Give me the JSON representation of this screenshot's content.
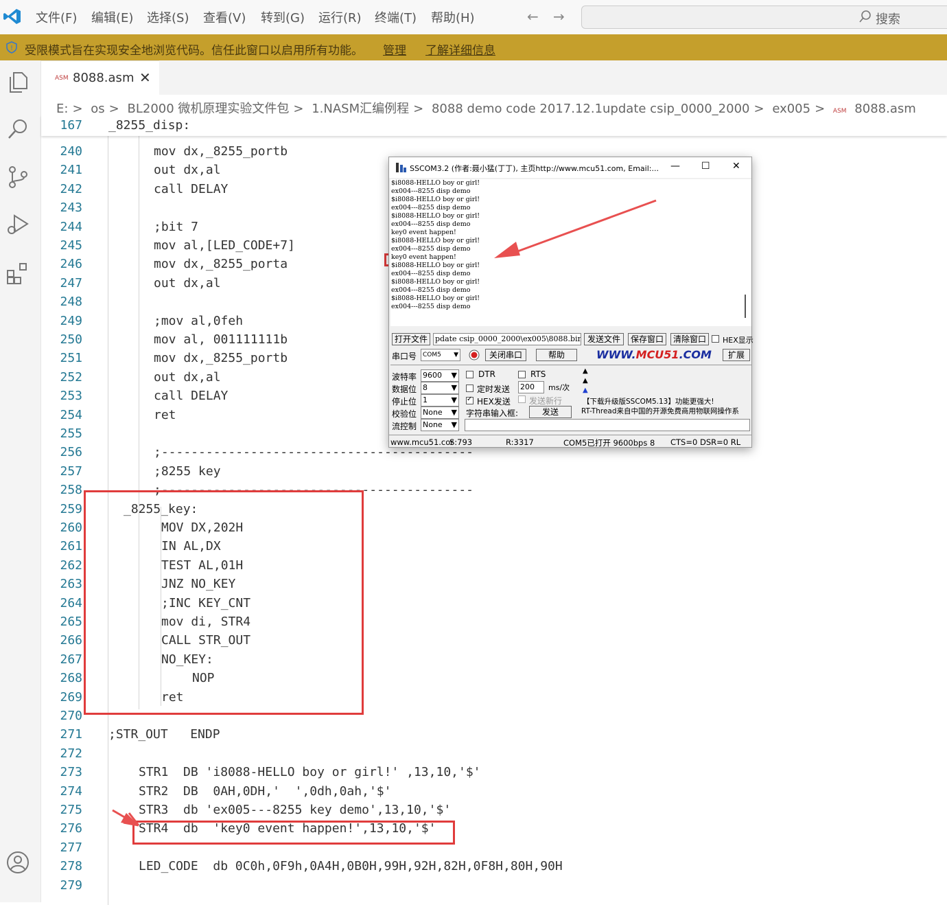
{
  "menubar": {
    "items": [
      "文件(F)",
      "编辑(E)",
      "选择(S)",
      "查看(V)",
      "转到(G)",
      "运行(R)",
      "终端(T)",
      "帮助(H)"
    ],
    "search_placeholder": "搜索"
  },
  "restricted_banner": {
    "text": "受限模式旨在实现安全地浏览代码。信任此窗口以启用所有功能。",
    "manage": "管理",
    "learn_more": "了解详细信息"
  },
  "tab": {
    "badge": "ASM",
    "name": "8088.asm"
  },
  "breadcrumb": [
    "E:",
    "os",
    "BL2000 微机原理实验文件包",
    "1.NASM汇编例程",
    "8088 demo code 2017.12.1update csip_0000_2000",
    "ex005",
    "8088.asm"
  ],
  "sticky_line": {
    "number": "167",
    "code": "_8255_disp:"
  },
  "lines": [
    {
      "n": "240",
      "code": "mov dx,_8255_portb",
      "indent": 3
    },
    {
      "n": "241",
      "code": "out dx,al",
      "indent": 3
    },
    {
      "n": "242",
      "code": "call DELAY",
      "indent": 3
    },
    {
      "n": "243",
      "code": "",
      "indent": 3
    },
    {
      "n": "244",
      "code": ";bit 7",
      "indent": 3
    },
    {
      "n": "245",
      "code": "mov al,[LED_CODE+7]",
      "indent": 3
    },
    {
      "n": "246",
      "code": "mov dx,_8255_porta",
      "indent": 3
    },
    {
      "n": "247",
      "code": "out dx,al",
      "indent": 3
    },
    {
      "n": "248",
      "code": "",
      "indent": 3
    },
    {
      "n": "249",
      "code": ";mov al,0feh",
      "indent": 3
    },
    {
      "n": "250",
      "code": "mov al, 001111111b",
      "indent": 3
    },
    {
      "n": "251",
      "code": "mov dx,_8255_portb",
      "indent": 3
    },
    {
      "n": "252",
      "code": "out dx,al",
      "indent": 3
    },
    {
      "n": "253",
      "code": "call DELAY",
      "indent": 3
    },
    {
      "n": "254",
      "code": "ret",
      "indent": 3
    },
    {
      "n": "255",
      "code": "",
      "indent": 3
    },
    {
      "n": "256",
      "code": ";------------------------------------------",
      "indent": 3
    },
    {
      "n": "257",
      "code": ";8255 key",
      "indent": 3
    },
    {
      "n": "258",
      "code": ";------------------------------------------",
      "indent": 3
    },
    {
      "n": "259",
      "code": "_8255_key:",
      "indent": 1
    },
    {
      "n": "260",
      "code": "MOV DX,202H",
      "indent": 2
    },
    {
      "n": "261",
      "code": "IN AL,DX",
      "indent": 2
    },
    {
      "n": "262",
      "code": "TEST AL,01H",
      "indent": 2
    },
    {
      "n": "263",
      "code": "JNZ NO_KEY",
      "indent": 2
    },
    {
      "n": "264",
      "code": ";INC KEY_CNT",
      "indent": 2
    },
    {
      "n": "265",
      "code": "mov di, STR4",
      "indent": 2
    },
    {
      "n": "266",
      "code": "CALL STR_OUT",
      "indent": 2
    },
    {
      "n": "267",
      "code": "NO_KEY:",
      "indent": 2
    },
    {
      "n": "268",
      "code": "NOP",
      "indent": 4
    },
    {
      "n": "269",
      "code": "ret",
      "indent": 2
    },
    {
      "n": "270",
      "code": "",
      "indent": 0
    },
    {
      "n": "271",
      "code": ";STR_OUT   ENDP",
      "indent": 0
    },
    {
      "n": "272",
      "code": "",
      "indent": 0
    },
    {
      "n": "273",
      "code": "STR1  DB 'i8088-HELLO boy or girl!' ,13,10,'$'",
      "indent": 5
    },
    {
      "n": "274",
      "code": "STR2  DB  0AH,0DH,'  ',0dh,0ah,'$'",
      "indent": 5
    },
    {
      "n": "275",
      "code": "STR3  db 'ex005---8255 key demo',13,10,'$'",
      "indent": 5
    },
    {
      "n": "276",
      "code": "STR4  db  'key0 event happen!',13,10,'$'",
      "indent": 5
    },
    {
      "n": "277",
      "code": "",
      "indent": 0
    },
    {
      "n": "278",
      "code": "LED_CODE  db 0C0h,0F9h,0A4H,0B0H,99H,92H,82H,0F8H,80H,90H",
      "indent": 5
    },
    {
      "n": "279",
      "code": "",
      "indent": 0
    }
  ],
  "sscom": {
    "title": "SSCOM3.2 (作者:聂小猛(丁丁), 主页http://www.mcu51.com,  Email:...",
    "terminal_lines": [
      "$i8088-HELLO boy or girl!",
      "ex004---8255 disp demo",
      "$i8088-HELLO boy or girl!",
      "ex004---8255 disp demo",
      "$i8088-HELLO boy or girl!",
      "ex004---8255 disp demo",
      "key0 event happen!",
      "$i8088-HELLO boy or girl!",
      "ex004---8255 disp demo",
      "key0 event happen!",
      "$i8088-HELLO boy or girl!",
      "ex004---8255 disp demo",
      "$i8088-HELLO boy or girl!",
      "ex004---8255 disp demo",
      "$i8088-HELLO boy or girl!",
      "ex004---8255 disp demo"
    ],
    "open_file": "打开文件",
    "file_path": "pdate csip_0000_2000\\ex005\\8088.bin",
    "send_file": "发送文件",
    "save_window": "保存窗口",
    "clear_window": "清除窗口",
    "hex_display": "HEX显示",
    "port_label": "串口号",
    "port_value": "COM5",
    "close_port": "关闭串口",
    "help": "帮助",
    "brand_www": "WWW.",
    "brand_mcu": "MCU51",
    "brand_com": ".COM",
    "expand": "扩展",
    "baud_label": "波特率",
    "baud_value": "9600",
    "data_label": "数据位",
    "data_value": "8",
    "stop_label": "停止位",
    "stop_value": "1",
    "parity_label": "校验位",
    "parity_value": "None",
    "flow_label": "流控制",
    "flow_value": "None",
    "dtr": "DTR",
    "rts": "RTS",
    "timed_send": "定时发送",
    "interval": "200",
    "interval_unit": "ms/次",
    "hex_send": "HEX发送",
    "send_newline": "发送新行",
    "string_input": "字符串输入框:",
    "send": "发送",
    "ad_line1": "【下载升级版SSCOM5.13】功能更强大!",
    "ad_line2": "RT-Thread来自中国的开源免费商用物联网操作系",
    "status_site": "www.mcu51.cor",
    "status_sent": "S:793",
    "status_recv": "R:3317",
    "status_port": "COM5已打开  9600bps  8",
    "status_lines": "CTS=0 DSR=0 RL"
  },
  "colors": {
    "accent_red": "#e03c3c",
    "banner": "#c59f2c",
    "line_number": "#237893"
  }
}
